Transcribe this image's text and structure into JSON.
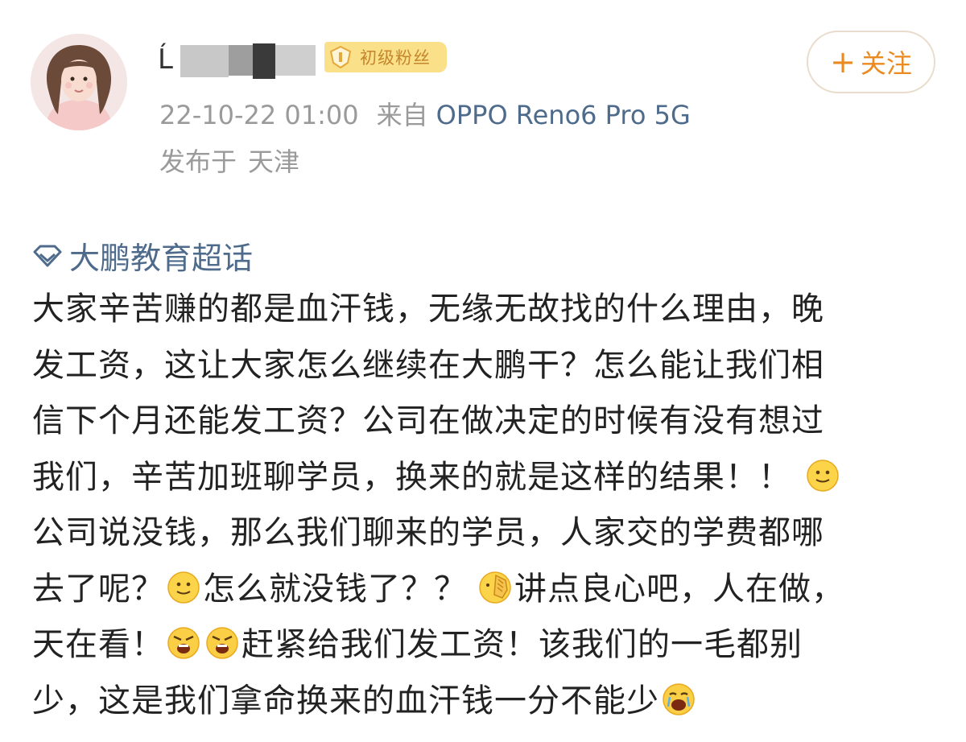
{
  "post": {
    "username_visible": "Ĺ",
    "badge": {
      "label": "初级粉丝",
      "color": "#fbe08a",
      "text_color": "#c4862c"
    },
    "follow": {
      "plus": "+",
      "label": "关注"
    },
    "timestamp": "22-10-22 01:00",
    "source_prefix": "来自",
    "device": "OPPO Reno6 Pro 5G",
    "location_prefix": "发布于",
    "location": "天津",
    "topic": "大鹏教育超话",
    "topic_icon": "diamond-icon",
    "colors": {
      "link": "#4f6b8c",
      "follow_accent": "#ea8a20",
      "meta_gray": "#9a9a9a",
      "text": "#222222"
    }
  },
  "content": {
    "l1": "大家辛苦赚的都是血汗钱，无缘无故找的什么理由，晚",
    "l2": "发工资，这让大家怎么继续在大鹏干？怎么能让我们相",
    "l3": "信下个月还能发工资？公司在做决定的时候有没有想过",
    "l4": "我们，辛苦加班聊学员，换来的就是这样的结果！！",
    "l5": "公司说没钱，那么我们聊来的学员，人家交的学费都哪",
    "l6a": "去了呢？",
    "l6b": "怎么就没钱了？？",
    "l6c": "讲点良心吧，人在做，",
    "l7a": "天在看！",
    "l7b": "赶紧给我们发工资！该我们的一毛都别",
    "l8": "少，这是我们拿命换来的血汗钱一分不能少"
  },
  "emojis": [
    "smile-emoji",
    "smile-emoji",
    "slap-emoji",
    "angry-emoji",
    "angry-emoji",
    "crying-emoji"
  ]
}
